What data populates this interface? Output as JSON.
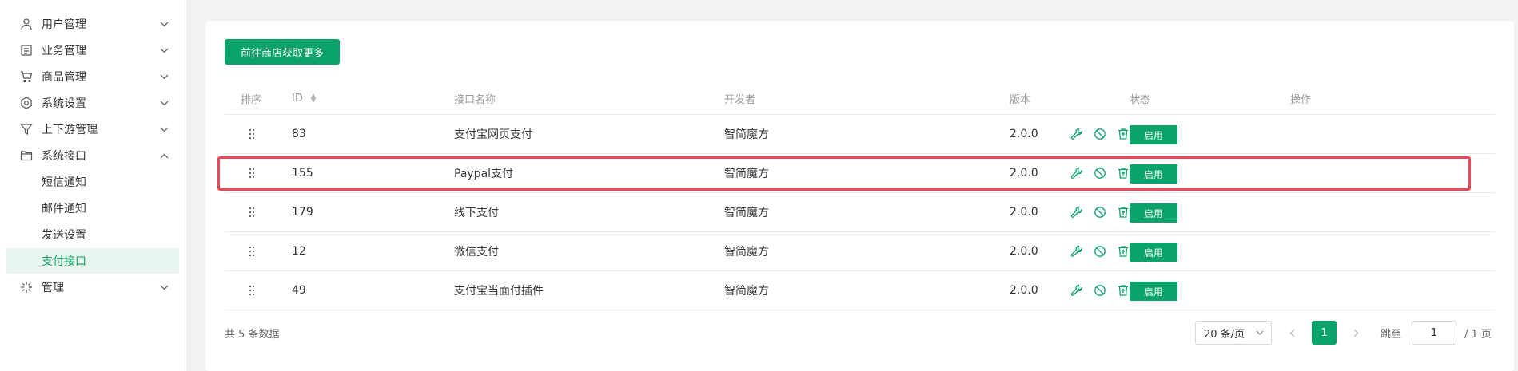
{
  "sidebar": {
    "menus": [
      {
        "label": "用户管理",
        "icon": "user-icon",
        "expanded": false
      },
      {
        "label": "业务管理",
        "icon": "document-icon",
        "expanded": false
      },
      {
        "label": "商品管理",
        "icon": "cart-icon",
        "expanded": false
      },
      {
        "label": "系统设置",
        "icon": "settings-icon",
        "expanded": false
      },
      {
        "label": "上下游管理",
        "icon": "filter-icon",
        "expanded": false
      },
      {
        "label": "系统接口",
        "icon": "folder-icon",
        "expanded": true
      },
      {
        "label": "管理",
        "icon": "sparkle-icon",
        "expanded": false
      }
    ],
    "sub_items": [
      {
        "label": "短信通知",
        "active": false
      },
      {
        "label": "邮件通知",
        "active": false
      },
      {
        "label": "发送设置",
        "active": false
      },
      {
        "label": "支付接口",
        "active": true
      }
    ]
  },
  "toolbar": {
    "store_button_label": "前往商店获取更多"
  },
  "table": {
    "headers": {
      "sort": "排序",
      "id": "ID",
      "name": "接口名称",
      "developer": "开发者",
      "version": "版本",
      "status": "状态",
      "actions": "操作"
    },
    "rows": [
      {
        "id": "83",
        "name": "支付宝网页支付",
        "developer": "智简魔方",
        "version": "2.0.0",
        "status": "启用"
      },
      {
        "id": "155",
        "name": "Paypal支付",
        "developer": "智简魔方",
        "version": "2.0.0",
        "status": "启用"
      },
      {
        "id": "179",
        "name": "线下支付",
        "developer": "智简魔方",
        "version": "2.0.0",
        "status": "启用"
      },
      {
        "id": "12",
        "name": "微信支付",
        "developer": "智简魔方",
        "version": "2.0.0",
        "status": "启用"
      },
      {
        "id": "49",
        "name": "支付宝当面付插件",
        "developer": "智简魔方",
        "version": "2.0.0",
        "status": "启用"
      }
    ]
  },
  "pagination": {
    "total_text": "共 5 条数据",
    "page_size": "20 条/页",
    "current_page": "1",
    "jump_label": "跳至",
    "jump_value": "1",
    "total_pages_text": "/ 1 页"
  },
  "colors": {
    "accent": "#0aa36a",
    "highlight": "#ea4a5f",
    "active_bg": "#e8f6ef"
  }
}
